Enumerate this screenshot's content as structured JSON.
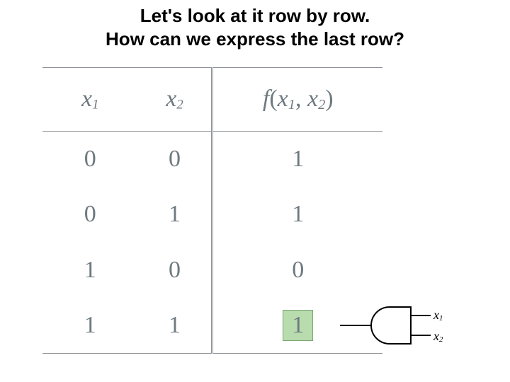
{
  "heading": {
    "line1": "Let's look at it row by row.",
    "line2": "How can we express the last row?"
  },
  "truth_table": {
    "headers": {
      "c1": "x",
      "c1_sub": "1",
      "c2": "x",
      "c2_sub": "2",
      "fn": "f",
      "fn_open": "(",
      "fn_a": "x",
      "fn_a_sub": "1",
      "fn_sep": ", ",
      "fn_b": "x",
      "fn_b_sub": "2",
      "fn_close": ")"
    },
    "rows": [
      {
        "x1": "0",
        "x2": "0",
        "f": "1",
        "hl": false
      },
      {
        "x1": "0",
        "x2": "1",
        "f": "1",
        "hl": false
      },
      {
        "x1": "1",
        "x2": "0",
        "f": "0",
        "hl": false
      },
      {
        "x1": "1",
        "x2": "1",
        "f": "1",
        "hl": true
      }
    ]
  },
  "gate": {
    "type": "AND",
    "inputs": [
      {
        "sym": "x",
        "sub": "1"
      },
      {
        "sym": "x",
        "sub": "2"
      }
    ]
  }
}
